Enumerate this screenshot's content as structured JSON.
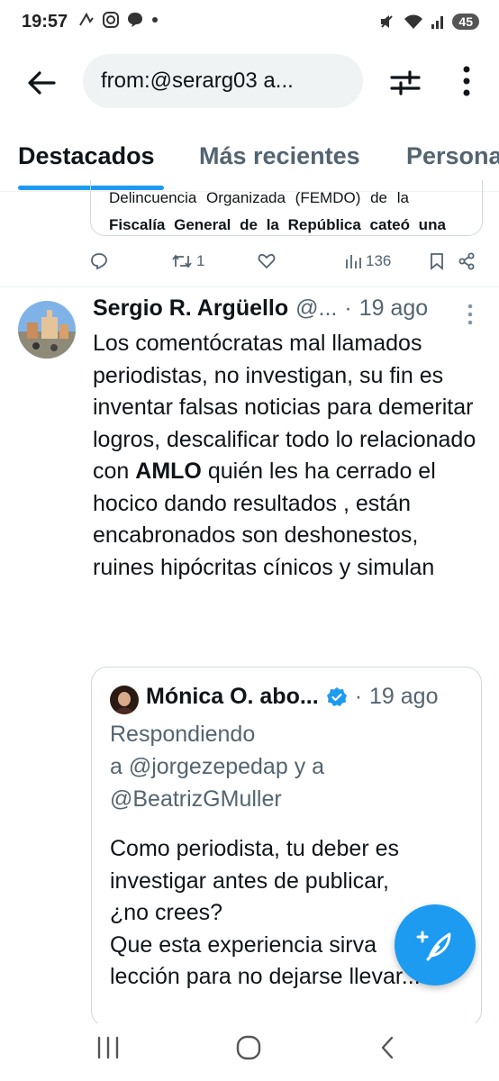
{
  "status_bar": {
    "time": "19:57",
    "battery": "45",
    "icons_left": [
      "gesture-icon",
      "instagram-icon",
      "chat-bubble-icon",
      "dot-icon"
    ],
    "icons_right": [
      "mute-icon",
      "wifi-icon",
      "signal-icon"
    ]
  },
  "header": {
    "search_query": "from:@serarg03 a...",
    "icons": [
      "back-arrow-icon",
      "filter-sliders-icon",
      "more-vertical-icon"
    ]
  },
  "tabs": [
    {
      "label": "Destacados",
      "active": true
    },
    {
      "label": "Más recientes",
      "active": false
    },
    {
      "label": "Personas",
      "active": false
    }
  ],
  "prev_tweet": {
    "quote_line1": "Delincuencia Organizada (FEMDO) de la",
    "quote_line2": "Fiscalía General de la República cateó una",
    "actions": {
      "reply_count": "",
      "retweet_count": "1",
      "like_count": "",
      "views": "136"
    }
  },
  "tweet": {
    "name": "Sergio R. Argüello",
    "handle": "@...",
    "separator": "·",
    "time": "19 ago",
    "body_part1": "Los comentócratas mal llamados periodistas, no investigan, su fin es inventar falsas noticias para demeritar logros, descalificar todo lo relacionado con ",
    "body_bold": "AMLO",
    "body_part2": " quién les ha cerrado el hocico dando resultados , están encabronados son deshonestos, ruines hipócritas cínicos y simulan"
  },
  "quoted": {
    "name": "Mónica O. abo...",
    "separator": "·",
    "time": "19 ago",
    "reply_line1": "Respondiendo",
    "reply_line2": "a @jorgezepedap y a",
    "reply_line3": "@BeatrizGMuller",
    "text_line1": "Como periodista, tu deber es",
    "text_line2": "investigar antes de publicar,",
    "text_line3": "¿no crees?",
    "text_line4": "Que esta experiencia sirva",
    "text_line5": "lección para no dejarse llevar..."
  },
  "colors": {
    "accent": "#1d9bf0",
    "secondary_text": "#536471",
    "primary_text": "#0f1419",
    "border": "#cfd9de"
  }
}
